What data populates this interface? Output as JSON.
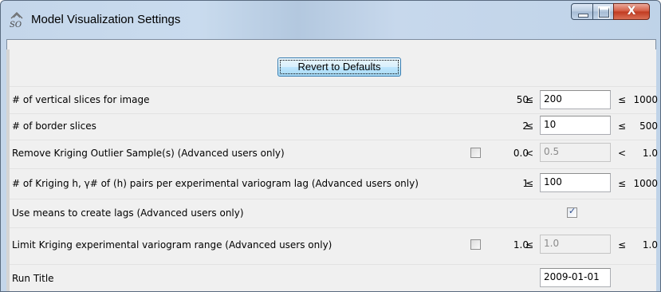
{
  "window": {
    "title": "Model Visualization Settings",
    "controls": {
      "minimize": "minimize",
      "maximize": "maximize",
      "close": "X"
    }
  },
  "revert_button": "Revert to Defaults",
  "rows": [
    {
      "label": "# of vertical slices for image",
      "min": "50",
      "op1": "≤",
      "value": "200",
      "op2": "≤",
      "max": "1000",
      "editable": true
    },
    {
      "label": "# of border slices",
      "min": "2",
      "op1": "≤",
      "value": "10",
      "op2": "≤",
      "max": "500",
      "editable": true
    },
    {
      "label": "Remove Kriging Outlier Sample(s) (Advanced users only)",
      "checkbox": false,
      "min": "0.0",
      "op1": "<",
      "value": "0.5",
      "op2": "<",
      "max": "1.0",
      "editable": false
    },
    {
      "label": "# of Kriging h, γ# of (h) pairs per experimental variogram lag (Advanced users only)",
      "min": "1",
      "op1": "≤",
      "value": "100",
      "op2": "≤",
      "max": "1000",
      "editable": true
    },
    {
      "label": "Use means to create lags (Advanced users only)",
      "checkbox": true
    },
    {
      "label": "Limit Kriging experimental variogram range (Advanced users only)",
      "checkbox": false,
      "min": "1.0",
      "op1": "≤",
      "value": "1.0",
      "op2": "≤",
      "max": "1.0",
      "editable": false
    },
    {
      "label": "Run Title",
      "value": "2009-01-01",
      "editable": true
    }
  ]
}
